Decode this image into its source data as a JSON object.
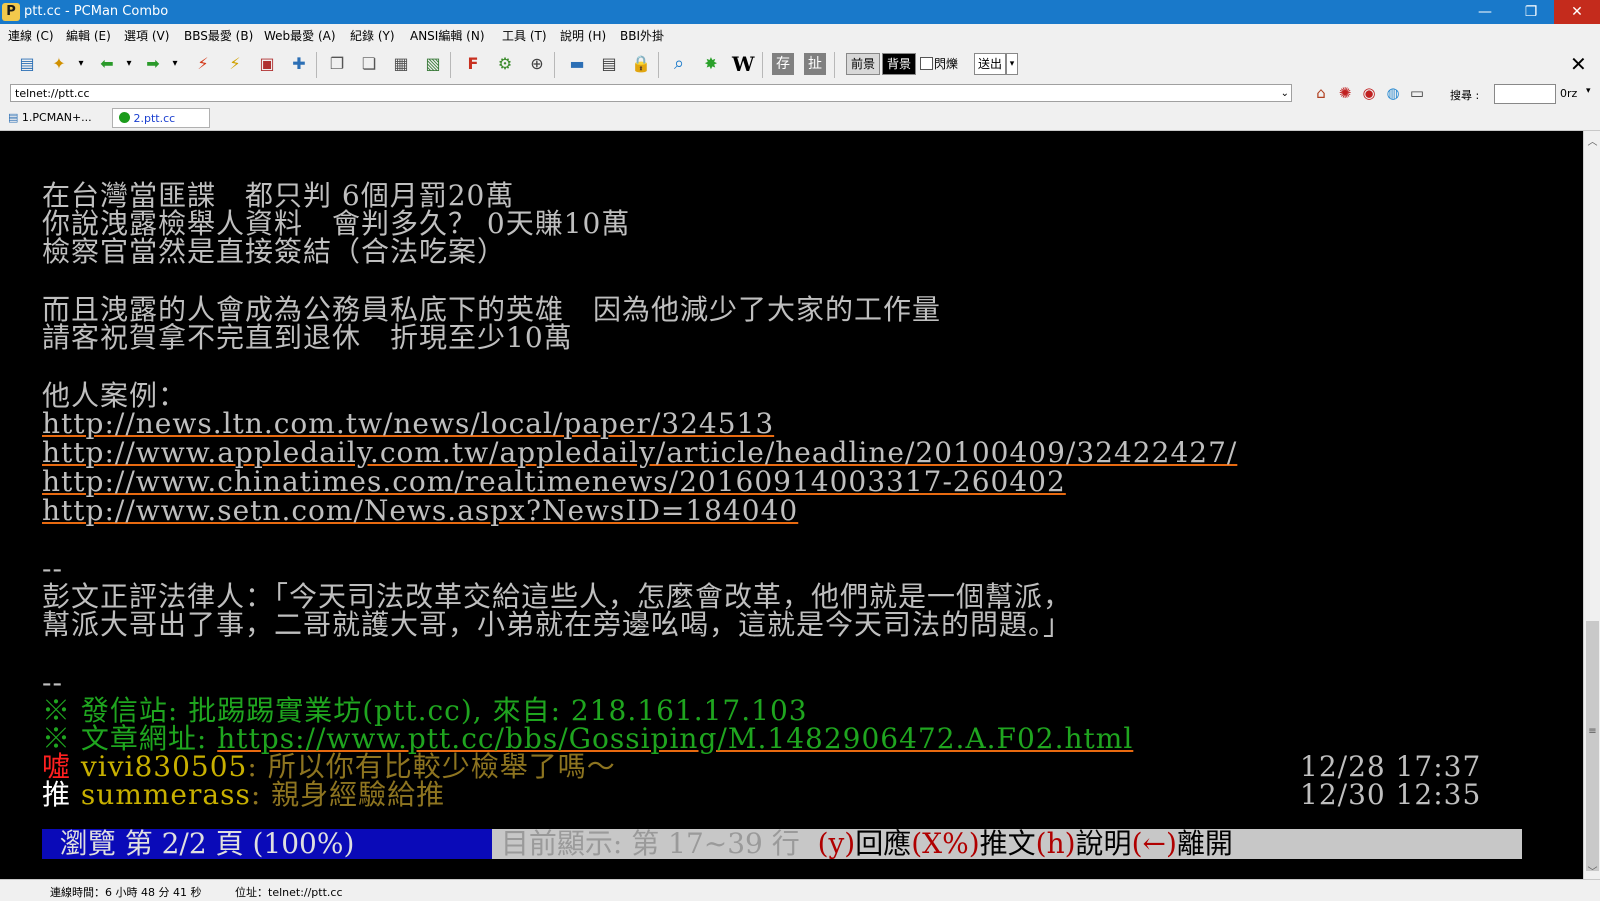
{
  "window": {
    "title": "ptt.cc - PCMan Combo",
    "app_icon": "pcman-icon",
    "minimize": "—",
    "maximize": "❐",
    "close": "✕"
  },
  "menu": [
    "連線 (C)",
    "編輯 (E)",
    "選項 (V)",
    "BBS最愛 (B)",
    "Web最愛 (A)",
    "紀錄 (Y)",
    "ANSI編輯 (N)",
    "工具 (T)",
    "說明 (H)",
    "BBI外掛"
  ],
  "toolbar": {
    "buttons": [
      {
        "name": "new-window-icon",
        "glyph": "▤",
        "color": "#2c6fb5"
      },
      {
        "name": "new-connection-icon",
        "glyph": "✦",
        "color": "#d09000"
      },
      {
        "name": "back-icon",
        "glyph": "⬅",
        "color": "#2a9a2a"
      },
      {
        "name": "forward-icon",
        "glyph": "➡",
        "color": "#2a9a2a"
      },
      {
        "name": "disconnect-icon",
        "glyph": "⚡",
        "color": "#d43a1a"
      },
      {
        "name": "reconnect-icon",
        "glyph": "⚡",
        "color": "#d0a000"
      },
      {
        "name": "close-connection-icon",
        "glyph": "▣",
        "color": "#b03030"
      },
      {
        "name": "pin-icon",
        "glyph": "✚",
        "color": "#2c6fb5"
      },
      {
        "name": "copy-icon",
        "glyph": "❐",
        "color": "#555555"
      },
      {
        "name": "paste-icon",
        "glyph": "❏",
        "color": "#555555"
      },
      {
        "name": "copy-ansi-icon",
        "glyph": "▦",
        "color": "#555555"
      },
      {
        "name": "screenshot-icon",
        "glyph": "▧",
        "color": "#3a7a3a"
      },
      {
        "name": "font-icon",
        "glyph": "F",
        "color": "#c83020"
      },
      {
        "name": "settings-gear-icon",
        "glyph": "⚙",
        "color": "#3a8a2a"
      },
      {
        "name": "fit-window-icon",
        "glyph": "⊕",
        "color": "#404040"
      },
      {
        "name": "fullscreen-icon",
        "glyph": "▬",
        "color": "#2c6fb5"
      },
      {
        "name": "address-book-icon",
        "glyph": "▤",
        "color": "#404040"
      },
      {
        "name": "lock-icon",
        "glyph": "🔒",
        "color": "#b08000"
      },
      {
        "name": "search-icon",
        "glyph": "⌕",
        "color": "#1979ca"
      },
      {
        "name": "plugin-star-icon",
        "glyph": "✸",
        "color": "#2aa02a"
      },
      {
        "name": "wikipedia-icon",
        "glyph": "W",
        "color": "#000000"
      },
      {
        "name": "save-icon",
        "glyph": "存",
        "color": "#ffffff"
      },
      {
        "name": "cut-icon",
        "glyph": "扯",
        "color": "#ffffff"
      }
    ],
    "fg_label": "前景",
    "bg_label": "背景",
    "blink_label": "閃爍",
    "send_label": "送出",
    "close": "✕"
  },
  "address": {
    "value": "telnet://ptt.cc",
    "search_label": "搜尋 :",
    "search_value": "",
    "engine": "0rz",
    "icons": [
      {
        "name": "home-icon",
        "glyph": "⌂",
        "color": "#b04020"
      },
      {
        "name": "antivirus-icon",
        "glyph": "✺",
        "color": "#c02020"
      },
      {
        "name": "history-icon",
        "glyph": "◉",
        "color": "#c02020"
      },
      {
        "name": "globe-icon",
        "glyph": "◍",
        "color": "#2a8ad0"
      },
      {
        "name": "monitor-icon",
        "glyph": "▭",
        "color": "#404040"
      }
    ]
  },
  "tabs": [
    {
      "label": "1.PCMAN+...",
      "icon": "page-icon",
      "active": false
    },
    {
      "label": "2.ptt.cc",
      "icon": "connected-dot-icon",
      "active": true
    }
  ],
  "terminal": {
    "body": [
      "在台灣當匪諜　都只判 6個月罰20萬",
      "你說洩露檢舉人資料　會判多久？ 0天賺10萬",
      "檢察官當然是直接簽結（合法吃案）",
      "",
      "而且洩露的人會成為公務員私底下的英雄　因為他減少了大家的工作量",
      "請客祝賀拿不完直到退休　折現至少10萬",
      "",
      "他人案例："
    ],
    "links": [
      "http://news.ltn.com.tw/news/local/paper/324513",
      "http://www.appledaily.com.tw/appledaily/article/headline/20100409/32422427/",
      "http://www.chinatimes.com/realtimenews/20160914003317-260402",
      "http://www.setn.com/News.aspx?NewsID=184040"
    ],
    "sig_sep": "--",
    "signature": [
      "彭文正評法律人：「今天司法改革交給這些人，怎麼會改革，他們就是一個幫派，",
      "幫派大哥出了事，二哥就護大哥，小弟就在旁邊吆喝，這就是今天司法的問題。」"
    ],
    "footer_sep": "--",
    "origin": "※ 發信站: 批踢踢實業坊(ptt.cc), 來自: 218.161.17.103",
    "url_prefix": "※ 文章網址: ",
    "url": "https://www.ptt.cc/bbs/Gossiping/M.1482906472.A.F02.html",
    "pushes": [
      {
        "tag": "噓",
        "user": "vivi830505",
        "content": ": 所以你有比較少檢舉了嗎～",
        "time": "12/28 17:37"
      },
      {
        "tag": "推",
        "user": "summerass",
        "content": ": 親身經驗給推",
        "time": "12/30 12:35"
      }
    ],
    "status": {
      "left": "  瀏覽 第 2/2 頁 (100%) ",
      "middle": " 目前顯示: 第 17~39 行  ",
      "keys": [
        {
          "key": "(y)",
          "label": "回應"
        },
        {
          "key": "(X%)",
          "label": "推文"
        },
        {
          "key": "(h)",
          "label": "說明"
        },
        {
          "key": "(←)",
          "label": "離開"
        }
      ]
    }
  },
  "statusbar": {
    "conn_time": "連線時間：6 小時 48 分 41 秒",
    "address": "位址：telnet://ptt.cc"
  }
}
